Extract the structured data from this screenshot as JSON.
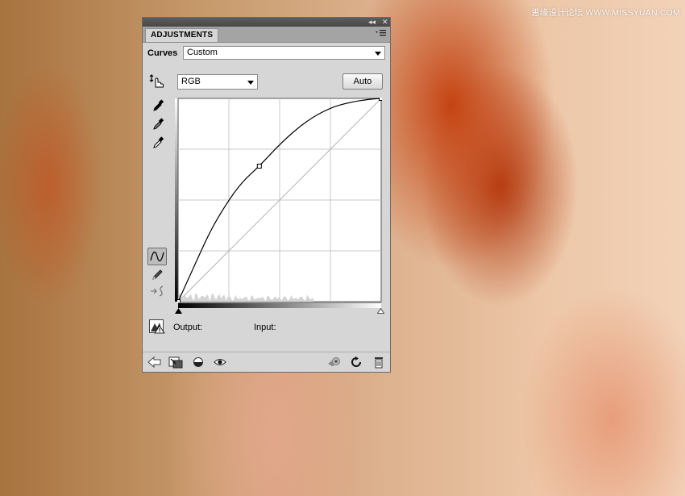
{
  "watermark": "思缘设计论坛  WWW.MISSYUAN.COM",
  "panel": {
    "tab_label": "ADJUSTMENTS",
    "title_buttons": [
      "◂◂",
      "✕"
    ],
    "menu_icon": "panel-menu-icon",
    "preset_label": "Curves",
    "preset_value": "Custom",
    "channel_value": "RGB",
    "auto_label": "Auto",
    "output_label": "Output:",
    "input_label": "Input:"
  },
  "curve": {
    "domain": [
      0,
      255
    ],
    "control_points": [
      [
        0,
        0
      ],
      [
        102,
        170
      ],
      [
        255,
        255
      ]
    ],
    "shape_samples": [
      [
        0,
        0
      ],
      [
        20,
        44
      ],
      [
        40,
        88
      ],
      [
        60,
        122
      ],
      [
        80,
        150
      ],
      [
        102,
        170
      ],
      [
        130,
        200
      ],
      [
        160,
        226
      ],
      [
        190,
        243
      ],
      [
        215,
        250
      ],
      [
        240,
        254
      ],
      [
        255,
        255
      ]
    ],
    "curve_color": "#000000",
    "grid_color": "#c8c8c8"
  },
  "icons": {
    "left_tools": [
      "target-adjust-icon",
      "black-eyedropper-icon",
      "gray-eyedropper-icon",
      "white-eyedropper-icon",
      "curve-tool-icon",
      "pencil-icon",
      "smooth-icon"
    ],
    "clip_warning": "clipping-warning-icon",
    "bottom_left": [
      "back-arrow-icon",
      "new-layer-icon",
      "visibility-circle-icon",
      "eye-icon"
    ],
    "bottom_right": [
      "previous-state-icon",
      "reset-icon",
      "trash-icon"
    ]
  }
}
